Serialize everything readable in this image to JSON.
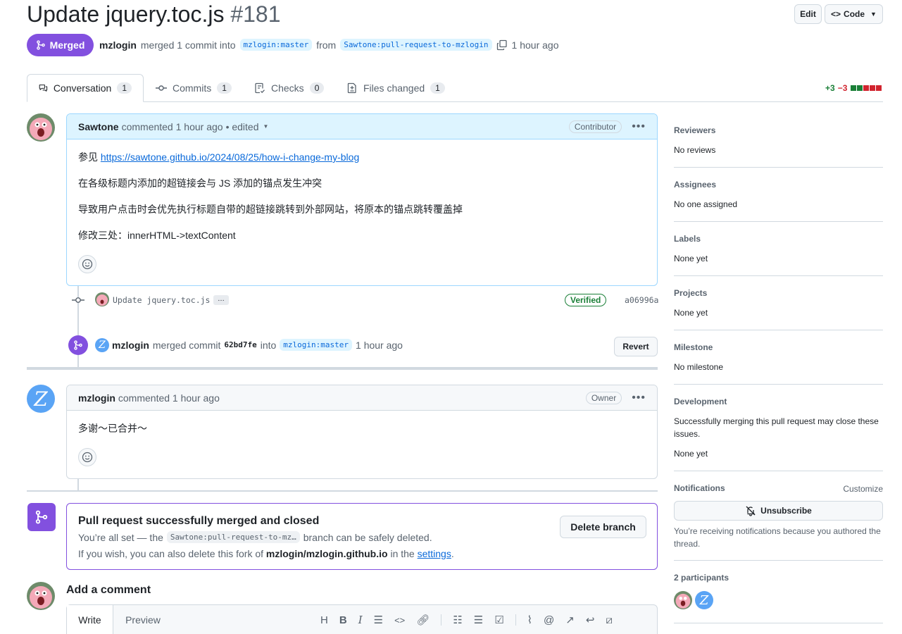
{
  "header": {
    "title": "Update jquery.toc.js",
    "number": "#181",
    "edit_label": "Edit",
    "code_label": "Code",
    "state_label": "Merged",
    "meta": {
      "user": "mzlogin",
      "text1": "merged 1 commit into",
      "base_branch": "mzlogin:master",
      "text2": "from",
      "head_branch": "Sawtone:pull-request-to-mzlogin",
      "time": "1 hour ago"
    }
  },
  "tabs": [
    {
      "label": "Conversation",
      "count": "1"
    },
    {
      "label": "Commits",
      "count": "1"
    },
    {
      "label": "Checks",
      "count": "0"
    },
    {
      "label": "Files changed",
      "count": "1"
    }
  ],
  "diffstat": {
    "additions": "+3",
    "deletions": "−3",
    "colors": [
      "#1a7f37",
      "#1a7f37",
      "#d1242f",
      "#d1242f",
      "#d1242f"
    ]
  },
  "comment1": {
    "author": "Sawtone",
    "action": "commented 1 hour ago",
    "edited": "• edited",
    "role": "Contributor",
    "link_prefix": "参见 ",
    "link": "https://sawtone.github.io/2024/08/25/how-i-change-my-blog",
    "p2": "在各级标题内添加的超链接会与 JS 添加的锚点发生冲突",
    "p3": "导致用户点击时会优先执行标题自带的超链接跳转到外部网站，将原本的锚点跳转覆盖掉",
    "p4": "修改三处：innerHTML->textContent"
  },
  "commit": {
    "message": "Update jquery.toc.js",
    "ellipsis": "…",
    "verified": "Verified",
    "sha": "a06996a"
  },
  "merge_event": {
    "user": "mzlogin",
    "text1": "merged commit",
    "sha": "62bd7fe",
    "text2": "into",
    "branch": "mzlogin:master",
    "time": "1 hour ago",
    "revert_label": "Revert"
  },
  "comment2": {
    "author": "mzlogin",
    "action": "commented 1 hour ago",
    "role": "Owner",
    "body": "多谢～已合并～"
  },
  "merged_box": {
    "title": "Pull request successfully merged and closed",
    "line1_a": "You’re all set — the",
    "branch": "Sawtone:pull-request-to-mz…",
    "line1_b": "branch can be safely deleted.",
    "line2_a": "If you wish, you can also delete this fork of",
    "repo": "mzlogin/mzlogin.github.io",
    "line2_b": "in the",
    "settings": "settings",
    "period": ".",
    "delete_label": "Delete branch"
  },
  "add_comment": {
    "title": "Add a comment",
    "write_tab": "Write",
    "preview_tab": "Preview"
  },
  "sidebar": {
    "reviewers": {
      "title": "Reviewers",
      "value": "No reviews"
    },
    "assignees": {
      "title": "Assignees",
      "value": "No one assigned"
    },
    "labels": {
      "title": "Labels",
      "value": "None yet"
    },
    "projects": {
      "title": "Projects",
      "value": "None yet"
    },
    "milestone": {
      "title": "Milestone",
      "value": "No milestone"
    },
    "development": {
      "title": "Development",
      "desc": "Successfully merging this pull request may close these issues.",
      "value": "None yet"
    },
    "notifications": {
      "title": "Notifications",
      "customize": "Customize",
      "button": "Unsubscribe",
      "desc": "You’re receiving notifications because you authored the thread."
    },
    "participants": {
      "title": "2 participants"
    }
  }
}
